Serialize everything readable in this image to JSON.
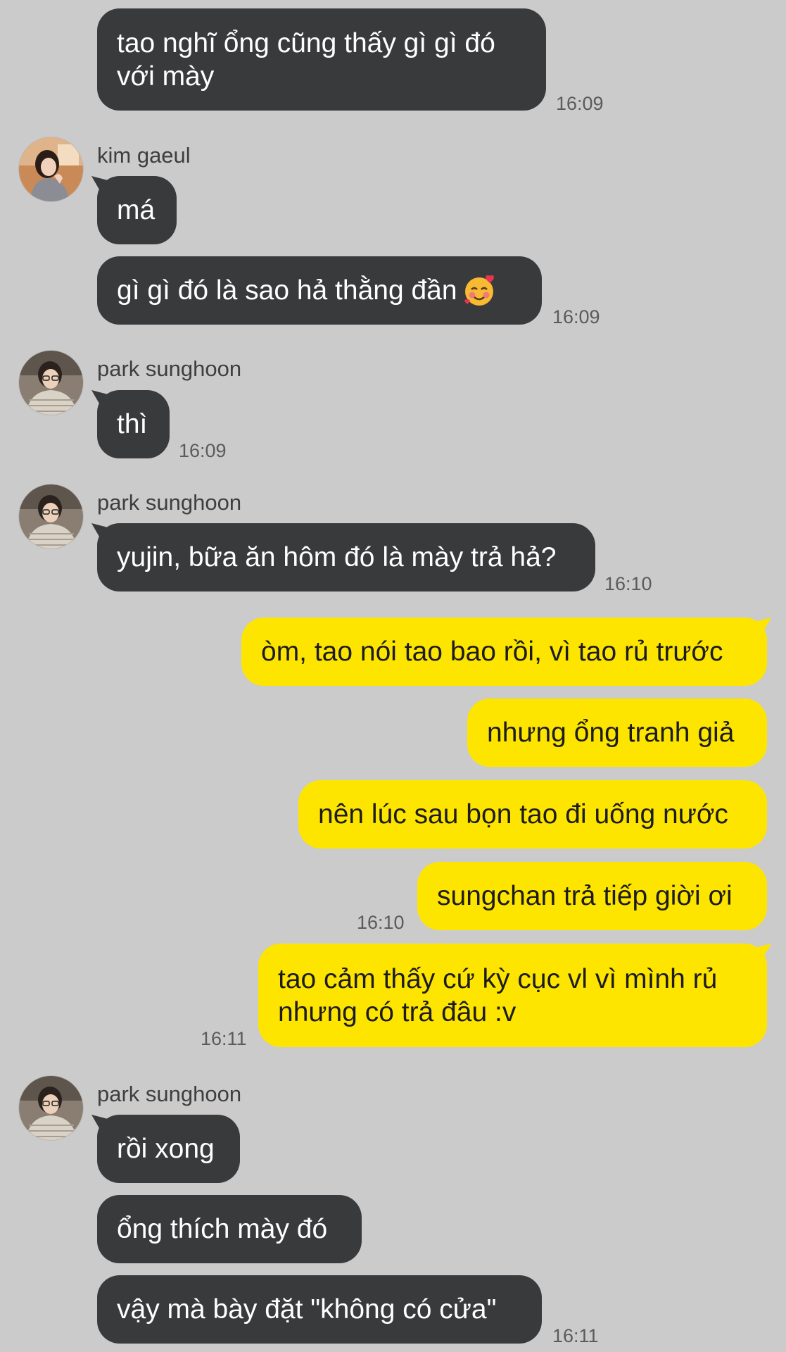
{
  "colors": {
    "background": "#cbcbcb",
    "incoming_bubble": "#393a3c",
    "outgoing_bubble": "#fee500",
    "timestamp": "#5b5b5b",
    "sender_name": "#3e3e3e"
  },
  "messages": [
    {
      "text": "tao nghĩ ổng cũng thấy gì gì đó",
      "text2": "với mày",
      "time": "16:09"
    },
    {
      "sender": "kim gaeul",
      "avatar": "kim-gaeul-avatar",
      "text": "má"
    },
    {
      "text": "gì gì đó là sao hả thằng đần",
      "emoji": "smiling-face-with-hearts-icon",
      "time": "16:09"
    },
    {
      "sender": "park sunghoon",
      "avatar": "park-sunghoon-avatar",
      "text": "thì",
      "time": "16:09"
    },
    {
      "sender": "park sunghoon",
      "avatar": "park-sunghoon-avatar",
      "text": "yujin, bữa ăn hôm đó là mày trả hả?",
      "time": "16:10"
    },
    {
      "text": "òm, tao nói tao bao rồi, vì tao rủ trước"
    },
    {
      "text": "nhưng ổng tranh giả"
    },
    {
      "text": "nên lúc sau bọn tao đi uống nước"
    },
    {
      "text": "sungchan trả tiếp giời ơi",
      "time": "16:10"
    },
    {
      "text": "tao cảm thấy cứ kỳ cục vl vì mình rủ",
      "text2": "nhưng có trả đâu :v",
      "time": "16:11"
    },
    {
      "sender": "park sunghoon",
      "avatar": "park-sunghoon-avatar",
      "text": "rồi xong"
    },
    {
      "text": "ổng thích mày đó"
    },
    {
      "text": "vậy mà bày đặt \"không có cửa\"",
      "time": "16:11"
    }
  ]
}
